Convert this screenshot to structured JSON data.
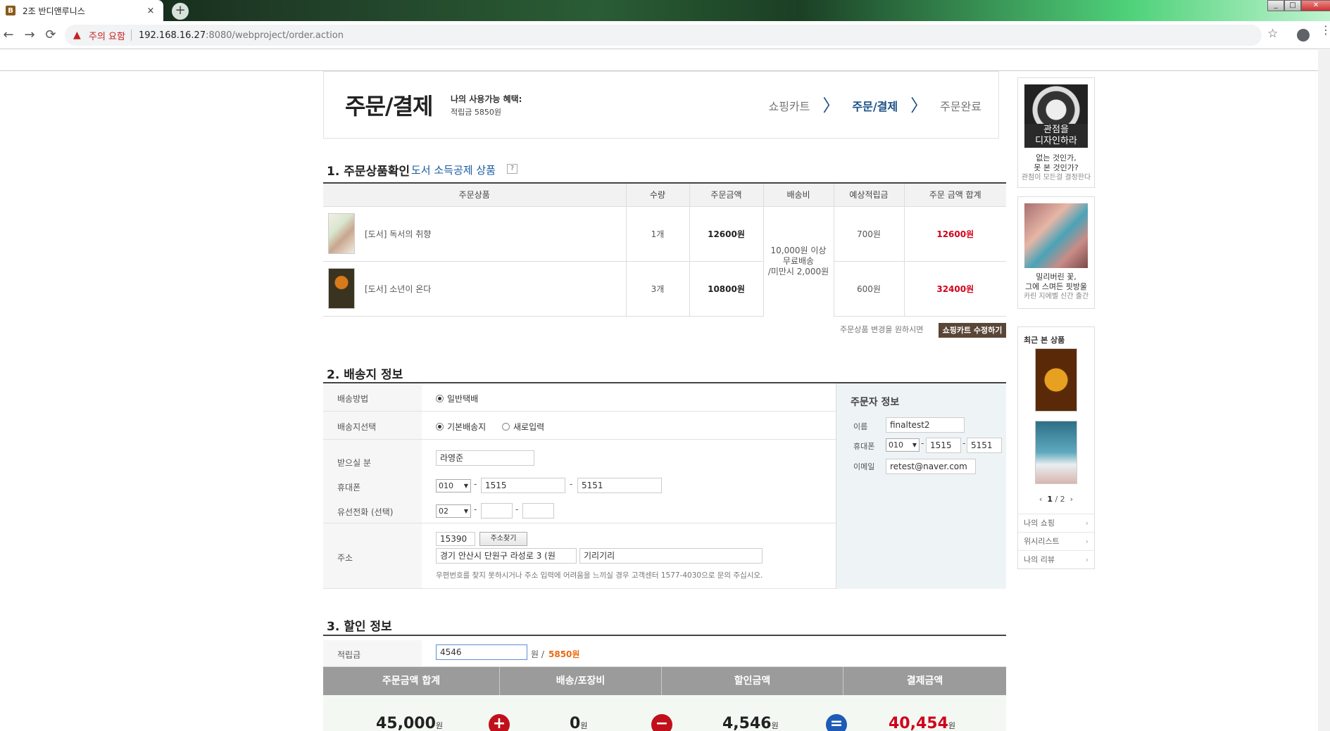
{
  "browser": {
    "tab_title": "2조 반디앤루니스",
    "tab_close": "×",
    "new_tab": "+",
    "favicon": "B",
    "back": "←",
    "forward": "→",
    "reload": "⟳",
    "warning_icon": "▲",
    "warning_text": "주의 요함",
    "url_host": "192.168.16.27",
    "url_rest": ":8080/webproject/order.action",
    "star": "☆",
    "menu": "⋮",
    "win_min": "_",
    "win_max": "□",
    "win_close": "✕"
  },
  "header": {
    "title": "주문/결제",
    "benefit_label": "나의 사용가능 혜택:",
    "benefit_value": "적립금 5850원",
    "steps": [
      "쇼핑카트",
      "주문/결제",
      "주문완료"
    ],
    "step_arrow": "〉"
  },
  "section1": {
    "title": "1. 주문상품확인",
    "subtitle": "도서 소득공제 상품",
    "help": "?",
    "columns": [
      "주문상품",
      "수량",
      "주문금액",
      "배송비",
      "예상적립금",
      "주문 금액 합계"
    ],
    "items": [
      {
        "name": "[도서] 독서의 취향",
        "qty": "1개",
        "price": "12600원",
        "points": "700원",
        "total": "12600원"
      },
      {
        "name": "[도서] 소년이 온다",
        "qty": "3개",
        "price": "10800원",
        "points": "600원",
        "total": "32400원"
      }
    ],
    "shipping_fee_lines": [
      "10,000원 이상",
      "무료배송",
      "/미만시 2,000원"
    ],
    "change_text": "주문상품 변경을 원하시면",
    "change_button": "쇼핑카트 수정하기"
  },
  "section2": {
    "title": "2. 배송지 정보",
    "method_label": "배송방법",
    "method_value": "일반택배",
    "dest_label": "배송지선택",
    "dest_options": [
      "기본배송지",
      "새로입력"
    ],
    "recipient_label": "받으실 분",
    "recipient_value": "라영준",
    "mobile_label": "휴대폰",
    "mobile": [
      "010",
      "1515",
      "5151"
    ],
    "phone_label": "유선전화 (선택)",
    "phone_area": "02",
    "address_label": "주소",
    "zipcode": "15390",
    "find_button": "주소찾기",
    "address1": "경기 안산시 단원구 라성로 3 (원",
    "address2": "기리기리",
    "note": "우편번호를 찾지 못하시거나 주소 입력에 어려움을 느끼실 경우 고객센터 1577-4030으로 문의 주십시오.",
    "dash": "-",
    "orderer": {
      "title": "주문자 정보",
      "name_label": "이름",
      "name_value": "finaltest2",
      "mobile_label": "휴대폰",
      "mobile": [
        "010",
        "1515",
        "5151"
      ],
      "email_label": "이메일",
      "email_value": "retest@naver.com"
    }
  },
  "section3": {
    "title": "3. 할인 정보",
    "points_label": "적립금",
    "points_input": "4546",
    "points_unit": "원 /",
    "points_available": "5850원",
    "summary_headers": [
      "주문금액 합계",
      "배송/포장비",
      "할인금액",
      "결제금액"
    ],
    "summary_values": [
      "45,000",
      "0",
      "4,546",
      "40,454"
    ],
    "won": "원",
    "ops": [
      "+",
      "−",
      "="
    ]
  },
  "sidebar": {
    "ad1_banner": [
      "관점을",
      "디자인하라"
    ],
    "ad1_caption": [
      "없는 것인가,",
      "못 본 것인가?",
      "관점이 모든걸 결정한다"
    ],
    "ad2_caption": [
      "밀리버린 꽃,",
      "그에 스며든 핏방울",
      "카린 지에벨 신간 출간"
    ],
    "recent_title": "최근 본 상품",
    "pager_prev": "‹",
    "pager_current": "1",
    "pager_total": "/ 2",
    "pager_next": "›",
    "links": [
      "나의 쇼핑",
      "위시리스트",
      "나의 리뷰"
    ],
    "chevron": "›"
  }
}
